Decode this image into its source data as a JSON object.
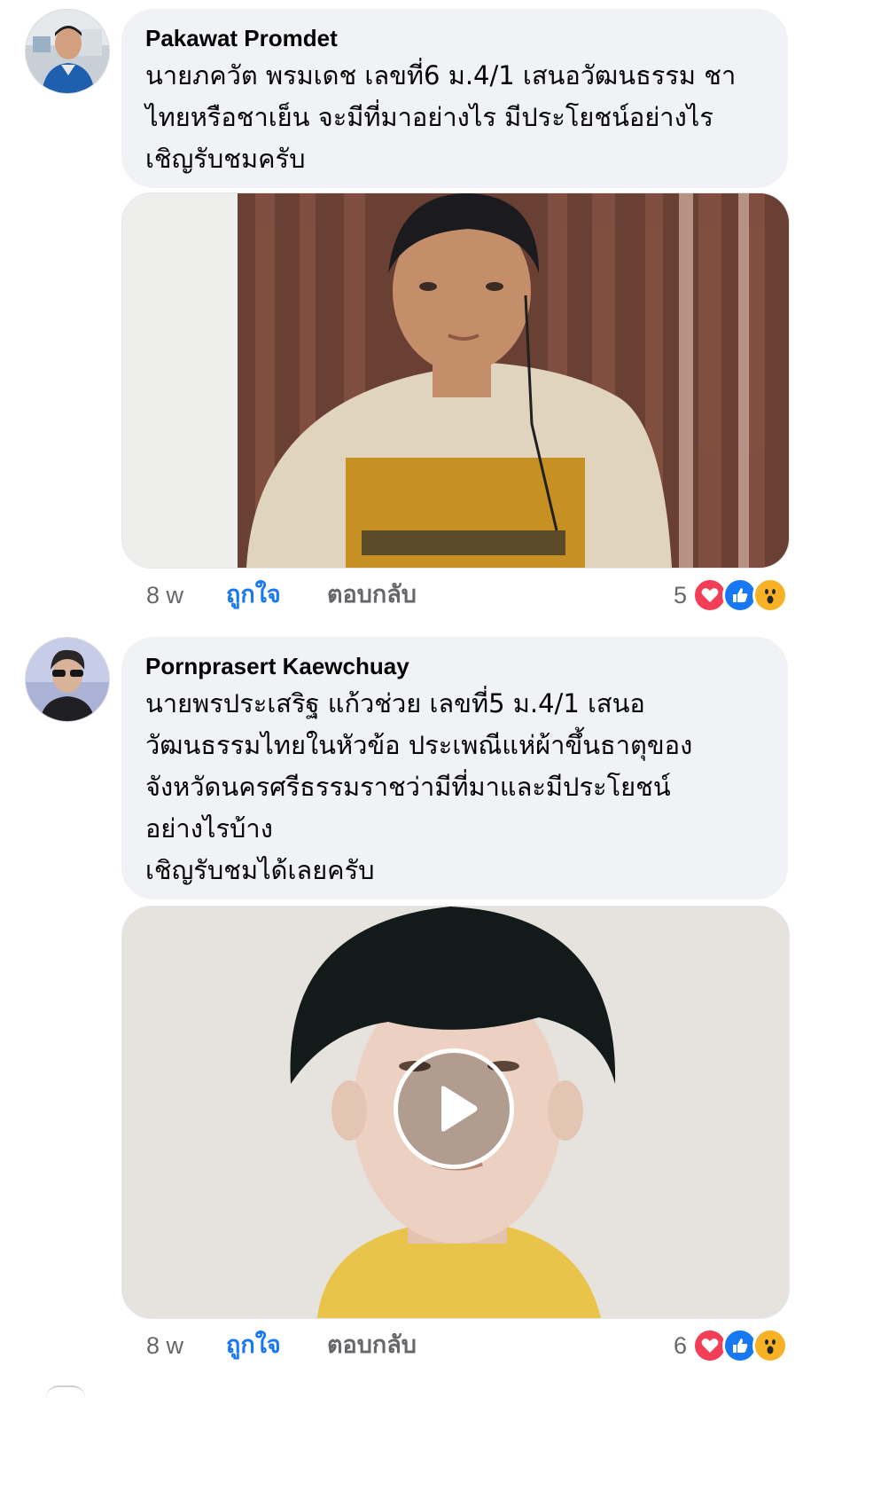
{
  "comments": [
    {
      "author": "Pakawat Promdet",
      "text": "นายภควัต พรมเดช เลขที่6 ม.4/1 เสนอวัฒนธรรม ชา\nไทยหรือชาเย็น จะมีที่มาอย่างไร มีประโยชน์อย่างไร\nเชิญรับชมครับ",
      "time": "8 w",
      "like_label": "ถูกใจ",
      "reply_label": "ตอบกลับ",
      "reaction_count": "5",
      "reactions": [
        "heart-icon",
        "like-icon",
        "wow-icon"
      ],
      "has_play_button": false
    },
    {
      "author": "Pornprasert Kaewchuay",
      "text": "นายพรประเสริฐ แก้วช่วย เลขที่5 ม.4/1 เสนอ\nวัฒนธรรมไทยในหัวข้อ ประเพณีแห่ผ้าขึ้นธาตุของ\nจังหวัดนครศรีธรรมราชว่ามีที่มาและมีประโยชน์\nอย่างไรบ้าง\nเชิญรับชมได้เลยครับ",
      "time": "8 w",
      "like_label": "ถูกใจ",
      "reply_label": "ตอบกลับ",
      "reaction_count": "6",
      "reactions": [
        "heart-icon",
        "like-icon",
        "wow-icon"
      ],
      "has_play_button": true
    }
  ],
  "colors": {
    "bubble": "#f0f2f5",
    "like_active": "#1877f2",
    "secondary_text": "#65676b",
    "heart": "#f33e58",
    "like": "#1877f2",
    "wow": "#f7b125"
  }
}
